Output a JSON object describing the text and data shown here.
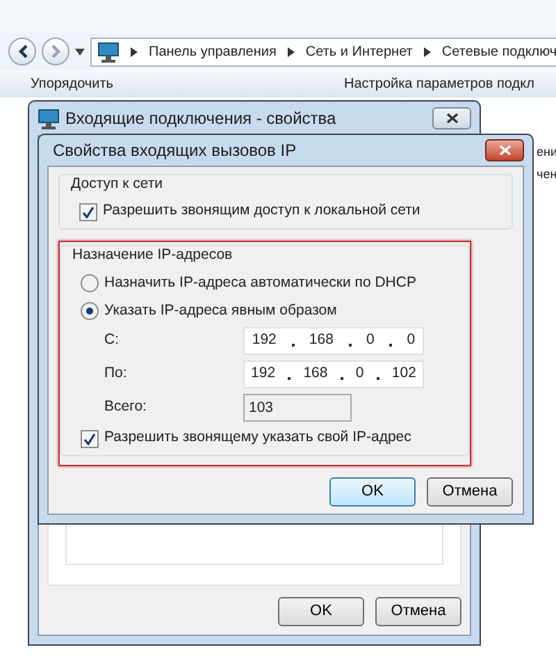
{
  "explorer": {
    "breadcrumb": [
      "Панель управления",
      "Сеть и Интернет",
      "Сетевые подключ"
    ],
    "toolbar": [
      "Упорядочить",
      "Настройка параметров подкл"
    ],
    "side_fragments": [
      "ени",
      "чен"
    ]
  },
  "outer_dialog": {
    "title": "Входящие подключения - свойства",
    "buttons": [
      "OK",
      "Отмена"
    ]
  },
  "inner_dialog": {
    "title": "Свойства входящих вызовов IP",
    "network_access": {
      "title": "Доступ к сети",
      "checkbox": {
        "label": "Разрешить звонящим доступ к локальной сети",
        "checked": true
      }
    },
    "ip_assignment": {
      "title": "Назначение IP-адресов",
      "options": [
        {
          "label": "Назначить IP-адреса автоматически по DHCP",
          "selected": false
        },
        {
          "label": "Указать IP-адреса явным образом",
          "selected": true
        }
      ],
      "fields": [
        {
          "label": "С:",
          "octets": [
            "192",
            "168",
            "0",
            "0"
          ]
        },
        {
          "label": "По:",
          "octets": [
            "192",
            "168",
            "0",
            "102"
          ]
        }
      ],
      "total": {
        "label": "Всего:",
        "value": "103"
      },
      "checkbox": {
        "label": "Разрешить звонящему указать свой IP-адрес",
        "checked": true
      }
    },
    "buttons": [
      "OK",
      "Отмена"
    ]
  }
}
